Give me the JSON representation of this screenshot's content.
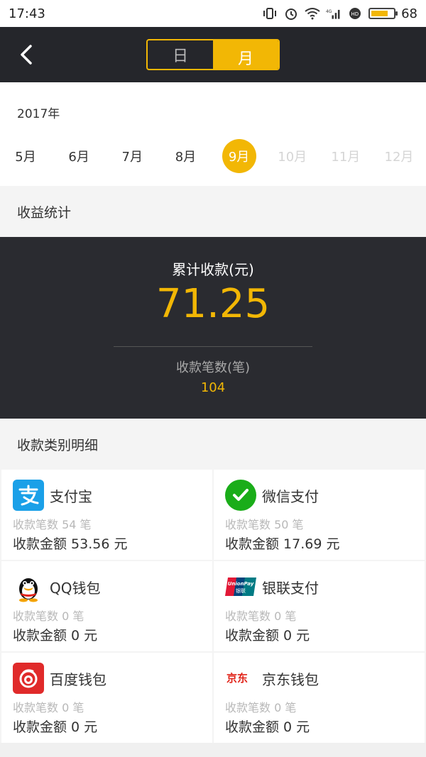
{
  "status_bar": {
    "time": "17:43",
    "battery_level": "68",
    "network": "4G"
  },
  "header": {
    "tabs": [
      {
        "label": "日"
      },
      {
        "label": "月"
      }
    ]
  },
  "date": {
    "year": "2017年",
    "months": [
      {
        "label": "5月"
      },
      {
        "label": "6月"
      },
      {
        "label": "7月"
      },
      {
        "label": "8月"
      },
      {
        "label": "9月"
      },
      {
        "label": "10月"
      },
      {
        "label": "11月"
      },
      {
        "label": "12月"
      }
    ]
  },
  "stats": {
    "title": "收益统计",
    "total_label": "累计收款(元)",
    "total_value": "71.25",
    "count_label": "收款笔数(笔)",
    "count_value": "104"
  },
  "details": {
    "title": "收款类别明细",
    "items": [
      {
        "name": "支付宝",
        "count": "收款笔数 54 笔",
        "amount": "收款金额 53.56 元",
        "icon": "alipay-icon"
      },
      {
        "name": "微信支付",
        "count": "收款笔数 50 笔",
        "amount": "收款金额 17.69 元",
        "icon": "wechat-pay-icon"
      },
      {
        "name": "QQ钱包",
        "count": "收款笔数 0 笔",
        "amount": "收款金额 0 元",
        "icon": "qq-wallet-icon"
      },
      {
        "name": "银联支付",
        "count": "收款笔数 0 笔",
        "amount": "收款金额 0 元",
        "icon": "unionpay-icon",
        "logo_text": "UnionPay 银联"
      },
      {
        "name": "百度钱包",
        "count": "收款笔数 0 笔",
        "amount": "收款金额 0 元",
        "icon": "baidu-wallet-icon"
      },
      {
        "name": "京东钱包",
        "count": "收款笔数 0 笔",
        "amount": "收款金额 0 元",
        "icon": "jd-wallet-icon",
        "logo_text": "京东"
      }
    ]
  },
  "colors": {
    "accent": "#f2b705",
    "dark": "#25262b",
    "panel": "#2a2b30"
  }
}
